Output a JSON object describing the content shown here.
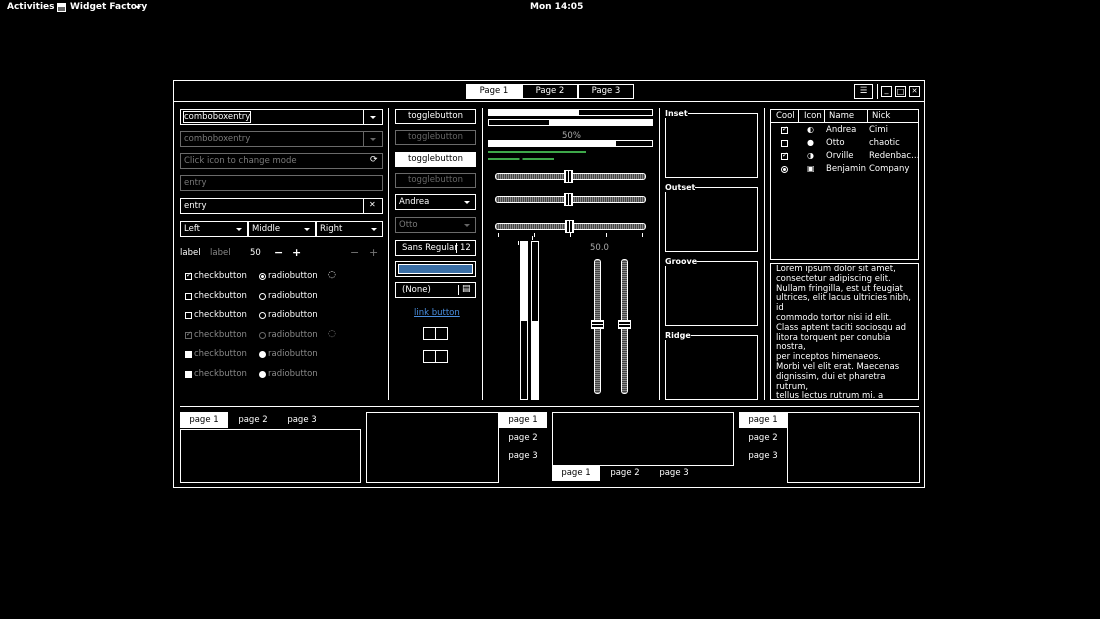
{
  "topbar": {
    "activities": "Activities",
    "app_name": "Widget Factory",
    "clock": "Mon 14:05"
  },
  "window": {
    "tabs": [
      "Page 1",
      "Page 2",
      "Page 3"
    ],
    "controls": {
      "menu": "☰",
      "minimize": "_",
      "maximize": "□",
      "close": "✕"
    }
  },
  "col1": {
    "combo1": "comboboxentry",
    "combo2": "comboboxentry",
    "icon_entry_placeholder": "Click icon to change mode",
    "entry_placeholder": "entry",
    "entry_value": "entry",
    "combos": [
      "Left",
      "Middle",
      "Right"
    ],
    "label1": "label",
    "label2": "label",
    "spin_value": "50",
    "checks": [
      "checkbutton",
      "checkbutton",
      "checkbutton",
      "checkbutton",
      "checkbutton",
      "checkbutton"
    ],
    "radios": [
      "radiobutton",
      "radiobutton",
      "radiobutton",
      "radiobutton",
      "radiobutton",
      "radiobutton"
    ]
  },
  "col2": {
    "toggles": [
      "togglebutton",
      "togglebutton",
      "togglebutton",
      "togglebutton"
    ],
    "combo_andrea": "Andrea",
    "combo_otto": "Otto",
    "font_name": "Sans Regular",
    "font_size": "12",
    "color_value": "#3a6ea5",
    "file_chooser": "(None)",
    "link": "link button"
  },
  "col3": {
    "progress_label": "50%",
    "progress1": 0.55,
    "progress2": 0.55,
    "progress3": 0.78,
    "scale_label": "50.0",
    "scale_value": 0.5
  },
  "frames": [
    "Inset",
    "Outset",
    "Groove",
    "Ridge"
  ],
  "treeview": {
    "headers": [
      "Cool",
      "Icon",
      "Name",
      "Nick"
    ],
    "rows": [
      {
        "name": "Andrea",
        "nick": "Cimi"
      },
      {
        "name": "Otto",
        "nick": "chaotic"
      },
      {
        "name": "Orville",
        "nick": "Redenbac…"
      },
      {
        "name": "Benjamin",
        "nick": "Company"
      }
    ]
  },
  "textview": "Lorem ipsum dolor sit amet,\nconsectetur adipiscing elit.\nNullam fringilla, est ut feugiat\nultrices, elit lacus ultricies nibh, id\ncommodo tortor nisi id elit.\nClass aptent taciti sociosqu ad\nlitora torquent per conubia nostra,\nper inceptos himenaeos.\nMorbi vel elit erat. Maecenas\ndignissim, dui et pharetra rutrum,\ntellus lectus rutrum mi, a convallis\nlibero nisi quis tellus.\nNulla facilisi. Nullam eleifend\nlobortis nisl, in porttitor tellus",
  "notebooks": {
    "nb1": [
      "page 1",
      "page 2",
      "page 3"
    ],
    "nb2": [
      "page 1",
      "page 2",
      "page 3"
    ],
    "nb3": [
      "page 1",
      "page 2",
      "page 3"
    ],
    "nb4": [
      "page 1",
      "page 2",
      "page 3"
    ]
  },
  "colors": {
    "progress_green": "#3ea84a",
    "color_button": "#3a6ea5"
  }
}
